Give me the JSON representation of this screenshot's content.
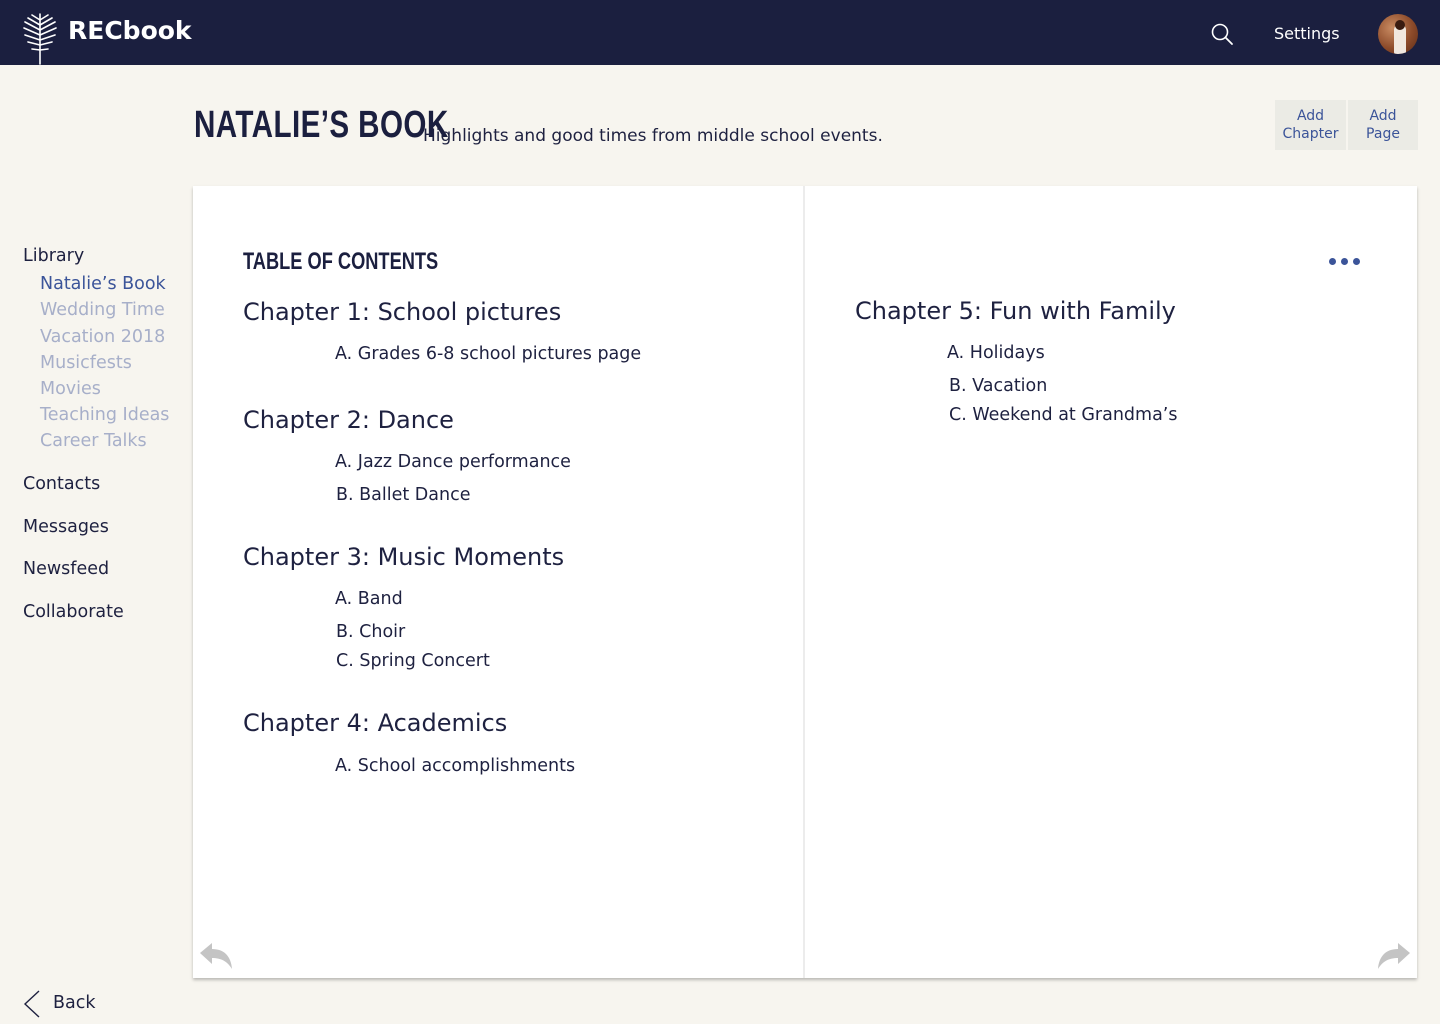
{
  "app": {
    "name": "RECbook",
    "settings_label": "Settings",
    "icons": {
      "logo": "palm-leaf-logo-icon",
      "search": "search-icon",
      "avatar": "user-avatar"
    }
  },
  "header": {
    "title": "NATALIE’S BOOK",
    "subtitle": "Highlights and good times from middle school events.",
    "buttons": {
      "add_chapter": [
        "Add",
        "Chapter"
      ],
      "add_page": [
        "Add",
        "Page"
      ]
    }
  },
  "sidebar": {
    "library_label": "Library",
    "library_items": [
      "Natalie’s Book",
      "Wedding Time",
      "Vacation 2018",
      "Musicfests",
      "Movies",
      "Teaching Ideas",
      "Career Talks"
    ],
    "active_library_item": "Natalie’s Book",
    "items": [
      "Contacts",
      "Messages",
      "Newsfeed",
      "Collaborate"
    ],
    "back_label": "Back"
  },
  "book": {
    "toc_heading": "TABLE OF CONTENTS",
    "left_page": {
      "chapters": [
        {
          "title": "Chapter 1: School pictures",
          "entries": [
            "A. Grades 6-8 school pictures page"
          ]
        },
        {
          "title": "Chapter 2: Dance",
          "entries": [
            "A. Jazz Dance performance",
            "B. Ballet Dance"
          ]
        },
        {
          "title": "Chapter 3: Music Moments",
          "entries": [
            "A. Band",
            "B. Choir",
            "C. Spring Concert"
          ]
        },
        {
          "title": "Chapter 4: Academics",
          "entries": [
            "A. School accomplishments"
          ]
        }
      ]
    },
    "right_page": {
      "chapters": [
        {
          "title": "Chapter 5: Fun with Family",
          "entries": [
            "A. Holidays",
            "B. Vacation",
            "C. Weekend at Grandma’s"
          ]
        }
      ]
    },
    "icons": {
      "more": "more-options-icon",
      "prev": "prev-page-arrow-icon",
      "next": "next-page-arrow-icon"
    }
  },
  "colors": {
    "topbar": "#1b1f3f",
    "background": "#f7f5ef",
    "accent": "#3b5499",
    "muted_link": "#a7afc9",
    "page": "#ffffff"
  }
}
